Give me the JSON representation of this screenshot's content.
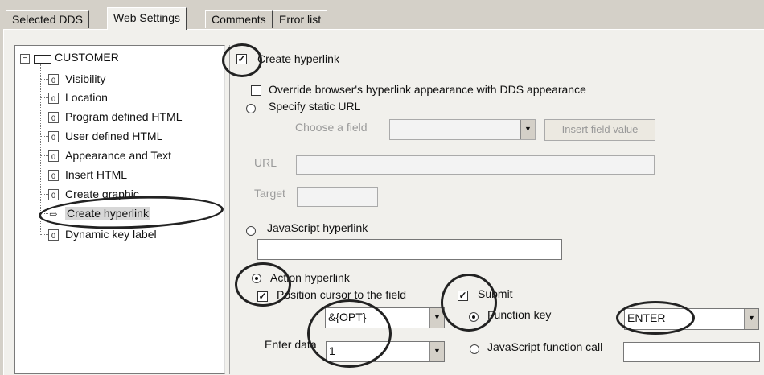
{
  "tabs": [
    {
      "label": "Selected DDS"
    },
    {
      "label": "Web Settings"
    },
    {
      "label": "Comments"
    },
    {
      "label": "Error list"
    }
  ],
  "tree": {
    "root": "CUSTOMER",
    "items": [
      {
        "label": "Visibility"
      },
      {
        "label": "Location"
      },
      {
        "label": "Program defined HTML"
      },
      {
        "label": "User defined HTML"
      },
      {
        "label": "Appearance and Text"
      },
      {
        "label": "Insert HTML"
      },
      {
        "label": "Create graphic"
      },
      {
        "label": "Create hyperlink"
      },
      {
        "label": "Dynamic key label"
      }
    ]
  },
  "form": {
    "create_hyperlink": "Create hyperlink",
    "override_appearance": "Override browser's hyperlink appearance with DDS appearance",
    "static_url": "Specify static URL",
    "choose_field": "Choose a field",
    "insert_field_value": "Insert field value",
    "url_label": "URL",
    "target_label": "Target",
    "javascript_hyperlink": "JavaScript hyperlink",
    "action_hyperlink": "Action hyperlink",
    "position_cursor": "Position cursor to the field",
    "position_value": "&{OPT}",
    "submit": "Submit",
    "function_key": "Function key",
    "function_key_value": "ENTER",
    "enter_data": "Enter data",
    "enter_data_value": "1",
    "javascript_function_call": "JavaScript function call"
  }
}
